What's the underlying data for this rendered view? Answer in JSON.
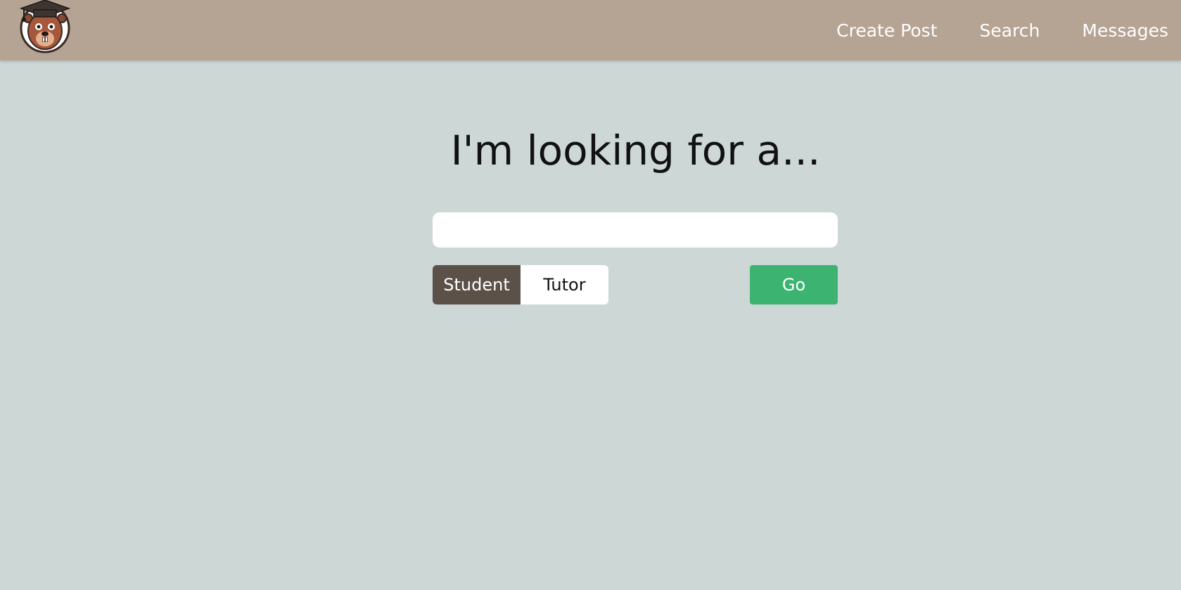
{
  "navbar": {
    "logo_icon": "beaver-graduate-logo-icon",
    "links": [
      {
        "label": "Create Post"
      },
      {
        "label": "Search"
      },
      {
        "label": "Messages"
      }
    ]
  },
  "main": {
    "heading": "I'm looking for a...",
    "search": {
      "value": "",
      "placeholder": ""
    },
    "role_toggle": {
      "options": [
        {
          "label": "Student",
          "selected": true
        },
        {
          "label": "Tutor",
          "selected": false
        }
      ]
    },
    "go_label": "Go"
  },
  "colors": {
    "navbar_bg": "#b5a394",
    "page_bg": "#ccd7d6",
    "selected_toggle": "#5c5148",
    "go_button": "#3cb371"
  }
}
